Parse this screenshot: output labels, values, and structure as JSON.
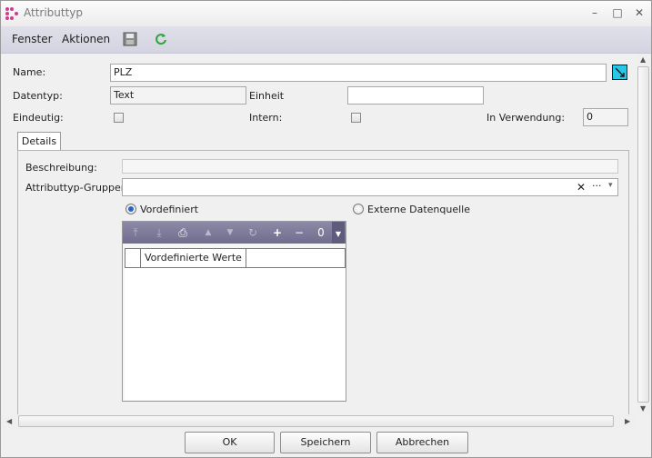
{
  "window": {
    "title": "Attributtyp",
    "minimize": "–",
    "maximize": "□",
    "close": "✕"
  },
  "menu": {
    "items": [
      "Fenster",
      "Aktionen"
    ],
    "icons": [
      "save-icon",
      "refresh-icon"
    ]
  },
  "form": {
    "name_label": "Name:",
    "name_value": "PLZ",
    "datentyp_label": "Datentyp:",
    "datentyp_value": "Text",
    "einheit_label": "Einheit",
    "einheit_value": "",
    "eindeutig_label": "Eindeutig:",
    "intern_label": "Intern:",
    "in_verwendung_label": "In Verwendung:",
    "in_verwendung_value": "0"
  },
  "tabs": [
    {
      "label": "Details",
      "active": true
    }
  ],
  "details": {
    "beschreibung_label": "Beschreibung:",
    "beschreibung_value": "",
    "gruppen_label": "Attributtyp-Gruppen:",
    "gruppen_clear": "✕",
    "gruppen_more": "···",
    "gruppen_dropdown": "▾",
    "radio_vordefiniert": "Vordefiniert",
    "radio_extern": "Externe Datenquelle",
    "selected_radio": "Vordefiniert"
  },
  "grid": {
    "toolbar_counter": "0",
    "add": "+",
    "remove": "−",
    "columns": [
      "",
      "Vordefinierte Werte",
      ""
    ],
    "rows": []
  },
  "buttons": {
    "ok": "OK",
    "save": "Speichern",
    "cancel": "Abbrechen"
  },
  "colors": {
    "accent_cyan": "#29c6e8",
    "grid_toolbar": "#7d7a9b",
    "app_icon": "#d23a8c"
  }
}
